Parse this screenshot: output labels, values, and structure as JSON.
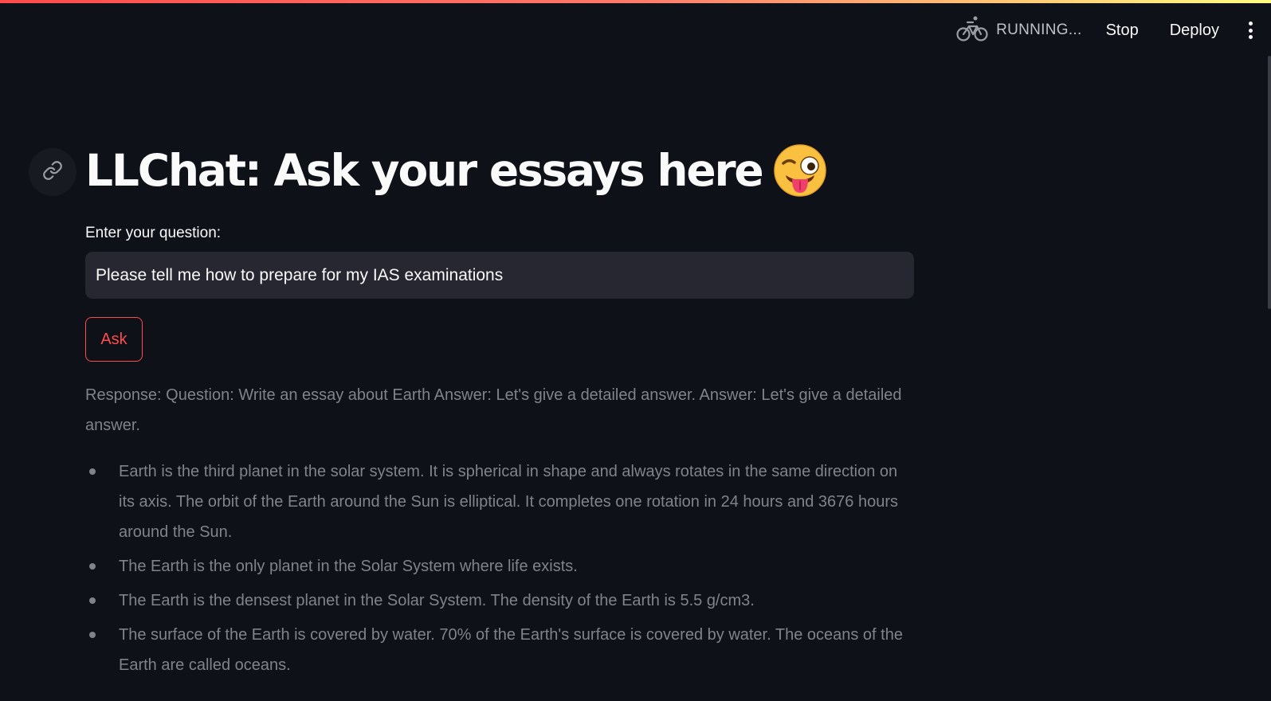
{
  "toolbar": {
    "status_icon": "bicycle-icon",
    "status_text": "RUNNING...",
    "stop_label": "Stop",
    "deploy_label": "Deploy",
    "menu_icon": "more-vertical-icon"
  },
  "header": {
    "title": "LLChat: Ask your essays here",
    "title_emoji": "winking-face-with-tongue-icon",
    "anchor_icon": "link-icon"
  },
  "form": {
    "question_label": "Enter your question:",
    "question_value": "Please tell me how to prepare for my IAS examinations",
    "ask_label": "Ask"
  },
  "response": {
    "intro": "Response: Question: Write an essay about Earth Answer: Let's give a detailed answer. Answer: Let's give a detailed answer.",
    "items": [
      "Earth is the third planet in the solar system. It is spherical in shape and always rotates in the same direction on its axis. The orbit of the Earth around the Sun is elliptical. It completes one rotation in 24 hours and 3676 hours around the Sun.",
      "The Earth is the only planet in the Solar System where life exists.",
      "The Earth is the densest planet in the Solar System. The density of the Earth is 5.5 g/cm3.",
      "The surface of the Earth is covered by water. 70% of the Earth's surface is covered by water. The oceans of the Earth are called oceans."
    ]
  },
  "colors": {
    "background": "#0e1117",
    "primary": "#ff4b4b",
    "input_background": "#262730",
    "response_text": "#808389"
  }
}
